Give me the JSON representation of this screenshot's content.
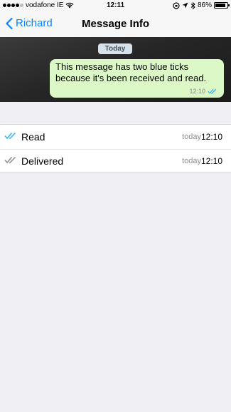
{
  "status_bar": {
    "carrier": "vodafone IE",
    "time": "12:11",
    "battery_percent": "86%",
    "battery_level": 0.86,
    "icons": [
      "signal-dots-icon",
      "wifi-icon",
      "rotation-lock-icon",
      "location-arrow-icon",
      "bluetooth-icon",
      "battery-icon"
    ]
  },
  "nav": {
    "back_label": "Richard",
    "title": "Message Info"
  },
  "chat": {
    "day_badge": "Today",
    "message_text": "This message has two blue ticks because it's been received and read.",
    "message_time": "12:10",
    "tick_color": "#34b7f1"
  },
  "info_rows": [
    {
      "label": "Read",
      "day": "today",
      "time": "12:10",
      "icon": "read-double-tick-icon",
      "color": "#34b7f1"
    },
    {
      "label": "Delivered",
      "day": "today",
      "time": "12:10",
      "icon": "delivered-double-tick-icon",
      "color": "#8e8e93"
    }
  ],
  "colors": {
    "accent": "#0a84ff",
    "bubble": "#dcf8c6",
    "page_bg": "#efeff4"
  }
}
